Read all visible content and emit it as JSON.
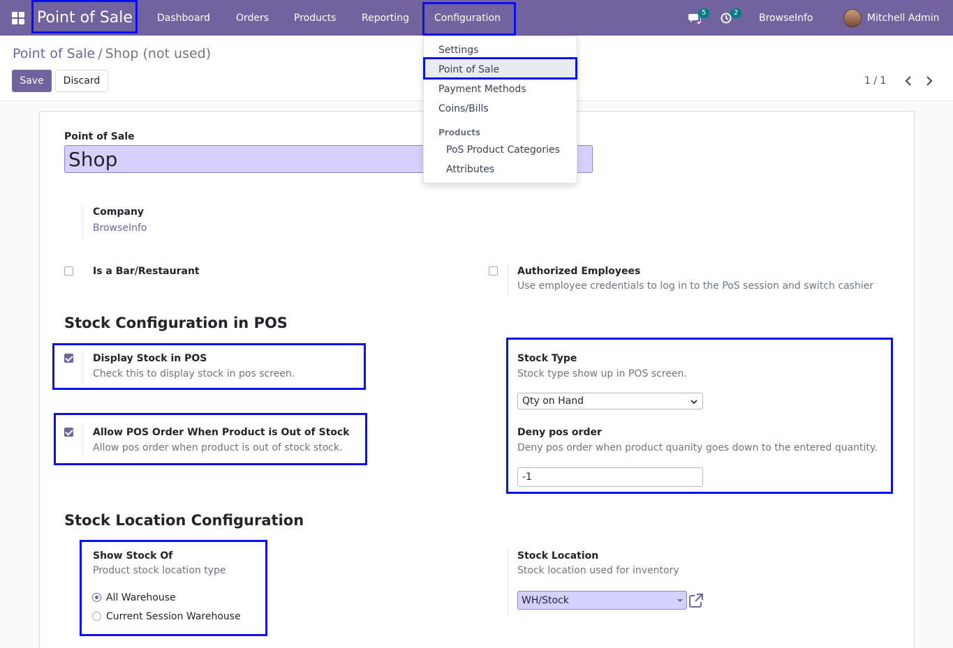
{
  "navbar": {
    "brand": "Point of Sale",
    "menu": {
      "dashboard": "Dashboard",
      "orders": "Orders",
      "products": "Products",
      "reporting": "Reporting",
      "configuration": "Configuration"
    },
    "messages_count": "5",
    "activities_count": "2",
    "company": "BrowseInfo",
    "user": "Mitchell Admin"
  },
  "control_panel": {
    "breadcrumb_parent": "Point of Sale",
    "breadcrumb_separator": "/",
    "breadcrumb_current": "Shop (not used)",
    "save_label": "Save",
    "discard_label": "Discard",
    "pager": "1 / 1"
  },
  "config_menu": {
    "settings": "Settings",
    "point_of_sale": "Point of Sale",
    "payment_methods": "Payment Methods",
    "coins_bills": "Coins/Bills",
    "products_header": "Products",
    "pos_product_categories": "PoS Product Categories",
    "attributes": "Attributes"
  },
  "form": {
    "name_label": "Point of Sale",
    "name_value": "Shop",
    "company_label": "Company",
    "company_value": "BrowseInfo",
    "is_bar_label": "Is a Bar/Restaurant",
    "is_bar_checked": false,
    "auth_employees_label": "Authorized Employees",
    "auth_employees_help": "Use employee credentials to log in to the PoS session and switch cashier",
    "auth_employees_checked": false,
    "stock_section_title": "Stock Configuration in POS",
    "display_stock_label": "Display Stock in POS",
    "display_stock_help": "Check this to display stock in pos screen.",
    "display_stock_checked": true,
    "allow_order_label": "Allow POS Order When Product is Out of Stock",
    "allow_order_help": "Allow pos order when product is out of stock stock.",
    "allow_order_checked": true,
    "stock_type_label": "Stock Type",
    "stock_type_help": "Stock type show up in POS screen.",
    "stock_type_value": "Qty on Hand",
    "deny_label": "Deny pos order",
    "deny_help": "Deny pos order when product quanity goes down to the entered quantity.",
    "deny_value": "-1",
    "location_section_title": "Stock Location Configuration",
    "show_stock_label": "Show Stock Of",
    "show_stock_help": "Product stock location type",
    "radio_all_label": "All Warehouse",
    "radio_current_label": "Current Session Warehouse",
    "radio_selected": "All Warehouse",
    "stock_location_label": "Stock Location",
    "stock_location_help": "Stock location used for inventory",
    "stock_location_value": "WH/Stock"
  },
  "colors": {
    "brand": "#71639e",
    "highlight": "#0a0ff0",
    "required_field": "#d3d1ff",
    "badge": "#017e84"
  }
}
